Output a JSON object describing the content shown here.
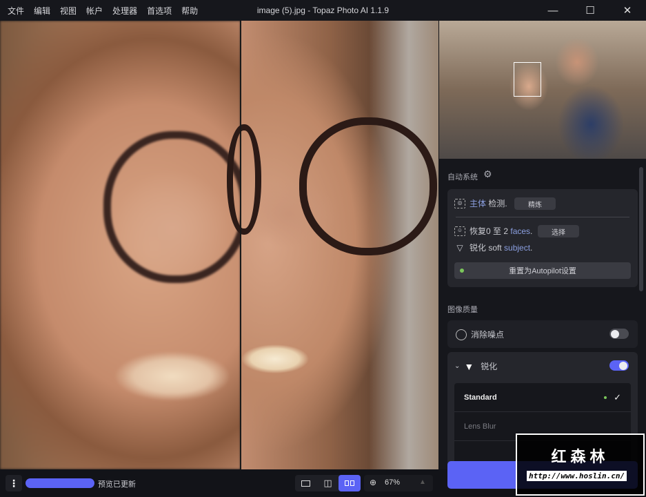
{
  "menu": [
    "文件",
    "编辑",
    "视图",
    "帐户",
    "处理器",
    "首选项",
    "帮助"
  ],
  "window_title": "image (5).jpg - Topaz Photo AI 1.1.9",
  "window_controls": {
    "minimize": "—",
    "maximize": "☐",
    "close": "✕"
  },
  "autopilot": {
    "title": "自动系统",
    "subject_label": "主体",
    "subject_suffix": " 检测.",
    "refine_button": "精炼",
    "faces_prefix": "恢复0 至 2 ",
    "faces_word": "faces",
    "faces_suffix": ".",
    "select_button": "选择",
    "sharpen_prefix": "锐化 soft ",
    "sharpen_word": "subject",
    "sharpen_suffix": ".",
    "reset_button": "重置为Autopilot设置"
  },
  "image_quality": {
    "title": "图像质量",
    "denoise": {
      "label": "消除噪点",
      "enabled": false
    },
    "sharpen": {
      "label": "锐化",
      "enabled": true,
      "models": [
        {
          "name": "Standard",
          "selected": true
        },
        {
          "name": "Lens Blur",
          "selected": false
        }
      ]
    }
  },
  "bottom": {
    "status": "预览已更新",
    "zoom": "67%",
    "view_modes": [
      "single",
      "split",
      "side-by-side"
    ],
    "active_view": "side-by-side"
  },
  "watermark": {
    "title": "红森林",
    "url": "http://www.hoslin.cn/"
  },
  "colors": {
    "accent": "#5b63f5",
    "link": "#8b9fe0",
    "ok": "#7bc65b"
  }
}
